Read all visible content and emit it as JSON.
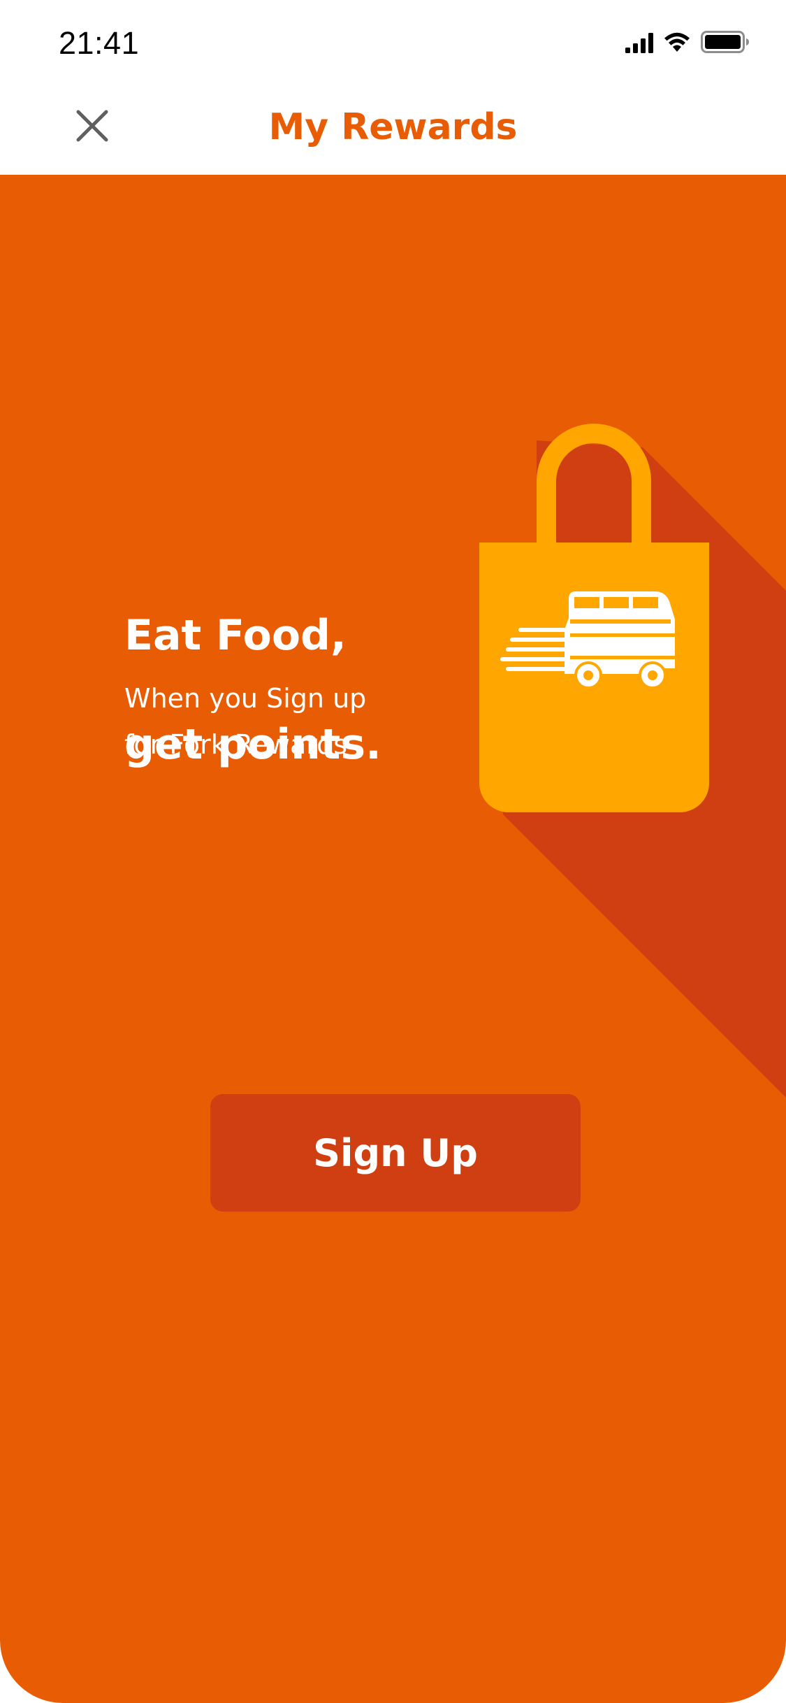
{
  "status_bar": {
    "time": "21:41",
    "icons": [
      "cellular-signal-icon",
      "wifi-icon",
      "battery-icon"
    ]
  },
  "header": {
    "title": "My Rewards",
    "close_icon": "close-icon"
  },
  "promo": {
    "headline_line1": "Eat Food,",
    "headline_line2": "get points.",
    "subtext_line1": "When you Sign up",
    "subtext_line2": "for Fork Rewards",
    "illustration": "shopping-bag-food-truck-icon"
  },
  "actions": {
    "signup_label": "Sign Up"
  },
  "colors": {
    "brand_orange": "#e85d04",
    "shadow_red": "#d03f11",
    "bag_yellow": "#ffa600",
    "title_orange": "#e85d04",
    "white": "#ffffff"
  }
}
